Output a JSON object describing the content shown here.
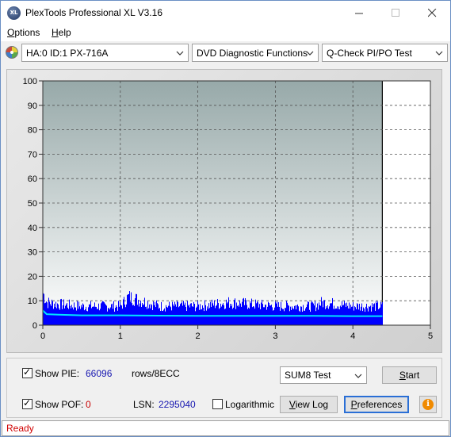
{
  "window": {
    "title": "PlexTools Professional XL V3.16",
    "icon_label": "XL"
  },
  "menu": {
    "items": [
      {
        "label": "Options",
        "underline": "O",
        "rest": "ptions"
      },
      {
        "label": "Help",
        "underline": "H",
        "rest": "elp"
      }
    ]
  },
  "toolbar": {
    "drive": "HA:0 ID:1  PX-716A",
    "function": "DVD Diagnostic Functions",
    "test": "Q-Check PI/PO Test"
  },
  "chart_data": {
    "type": "area",
    "xlim": [
      0,
      5
    ],
    "ylim": [
      0,
      100
    ],
    "x_ticks": [
      "0",
      "1",
      "2",
      "3",
      "4",
      "5"
    ],
    "y_ticks": [
      "100",
      "90",
      "80",
      "70",
      "60",
      "50",
      "40",
      "30",
      "20",
      "10",
      "0"
    ],
    "data_end_x": 4.38,
    "grid": true,
    "series": [
      {
        "values": [
          [
            0.0,
            17
          ],
          [
            0.05,
            12
          ],
          [
            0.2,
            11
          ],
          [
            0.5,
            10
          ],
          [
            1.0,
            10
          ],
          [
            1.1,
            15
          ],
          [
            1.5,
            10
          ],
          [
            2.0,
            10
          ],
          [
            2.4,
            12
          ],
          [
            3.0,
            10
          ],
          [
            3.5,
            10
          ],
          [
            3.6,
            12
          ],
          [
            4.0,
            10
          ],
          [
            4.38,
            10
          ]
        ]
      },
      {
        "values": [
          [
            0.0,
            6
          ],
          [
            0.05,
            4.5
          ],
          [
            0.2,
            4.3
          ],
          [
            0.5,
            4.0
          ],
          [
            1.0,
            4.0
          ],
          [
            1.5,
            3.9
          ],
          [
            2.0,
            3.8
          ],
          [
            2.5,
            3.8
          ],
          [
            3.0,
            3.8
          ],
          [
            3.5,
            3.8
          ],
          [
            4.0,
            3.7
          ],
          [
            4.38,
            3.7
          ]
        ]
      }
    ],
    "colors": {
      "bars": "#0000ff",
      "line": "#00e5ff",
      "bg_top": "#97a9a9",
      "bg_bottom": "#ffffff"
    }
  },
  "bottom": {
    "show_pie_label": "Show PIE:",
    "pie_value": "66096",
    "pie_unit": "rows/8ECC",
    "show_pof_label": "Show POF:",
    "pof_value": "0",
    "lsn_label": "LSN:",
    "lsn_value": "2295040",
    "logarithmic_label": "Logarithmic",
    "test_mode": "SUM8 Test",
    "start_label": "Start",
    "start_underline": "S",
    "start_rest": "tart",
    "view_log_label": "View Log",
    "view_log_underline": "V",
    "view_log_rest": "iew Log",
    "preferences_label": "Preferences",
    "preferences_underline": "P",
    "preferences_rest": "references"
  },
  "status": {
    "text": "Ready"
  }
}
